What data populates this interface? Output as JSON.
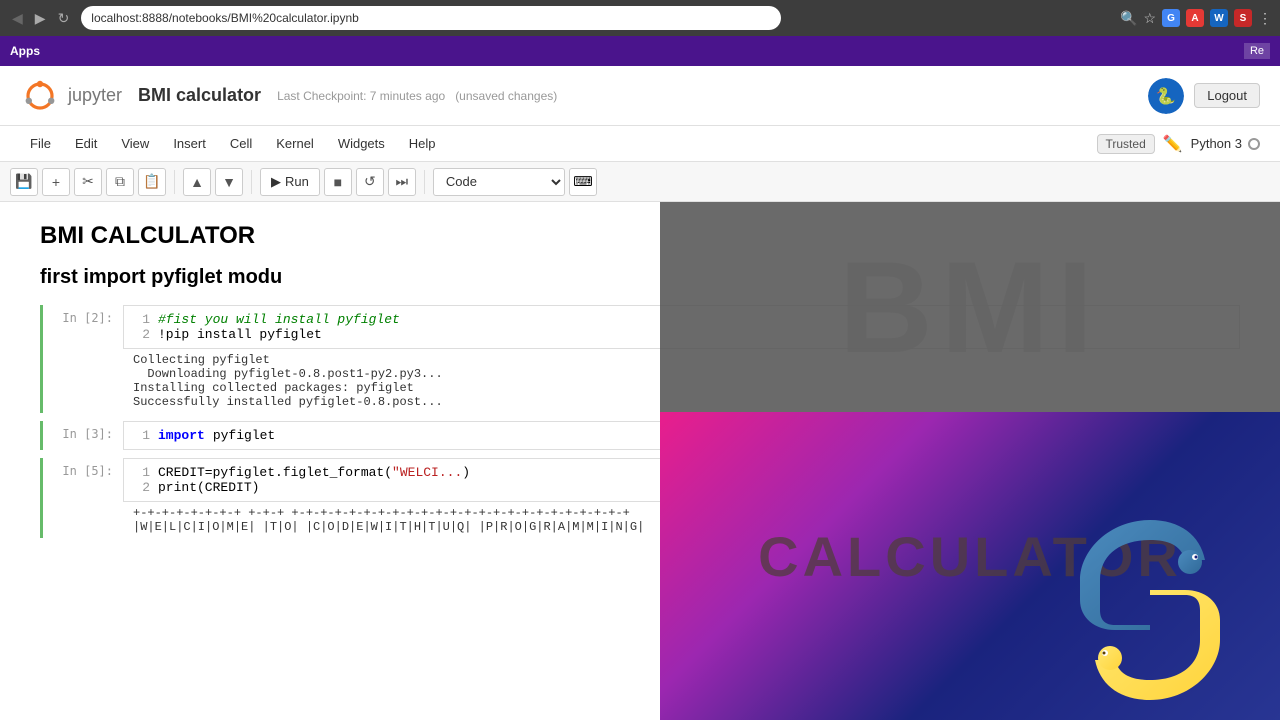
{
  "browser": {
    "url": "localhost:8888/notebooks/BMI%20calculator.ipynb",
    "nav_back": "◀",
    "nav_forward": "▶",
    "reload": "↻"
  },
  "apps": {
    "label": "Apps",
    "re_label": "Re"
  },
  "jupyter": {
    "logo_text": "jupyter",
    "notebook_title": "BMI calculator",
    "checkpoint_info": "Last Checkpoint: 7 minutes ago",
    "unsaved": "(unsaved changes)",
    "logout_label": "Logout"
  },
  "menu": {
    "items": [
      "File",
      "Edit",
      "View",
      "Insert",
      "Cell",
      "Kernel",
      "Widgets",
      "Help"
    ],
    "trusted": "Trusted",
    "kernel_name": "Python 3"
  },
  "toolbar": {
    "run_label": "Run",
    "cell_type": "Code"
  },
  "notebook": {
    "heading": "BMI CALCULATOR",
    "subheading": "first import pyfiglet modu",
    "cells": [
      {
        "prompt": "In [2]:",
        "lines": [
          {
            "num": "1",
            "content": "#fist you will install pyfiglet",
            "type": "comment"
          },
          {
            "num": "2",
            "content": "!pip install pyfiglet",
            "type": "code"
          }
        ],
        "output_lines": [
          "Collecting pyfiglet",
          "  Downloading pyfiglet-0.8.post1-py2.py3...",
          "Installing collected packages: pyfiglet",
          "Successfully installed pyfiglet-0.8.post..."
        ]
      },
      {
        "prompt": "In [3]:",
        "lines": [
          {
            "num": "1",
            "content_before": "",
            "kw": "import",
            "content_after": " pyfiglet",
            "type": "import"
          }
        ]
      },
      {
        "prompt": "In [5]:",
        "lines": [
          {
            "num": "1",
            "content": "CREDIT=pyfiglet.figlet_format(\"WELCI...",
            "type": "code"
          },
          {
            "num": "2",
            "content": "print(CREDIT)",
            "type": "code"
          }
        ],
        "output_lines": [
          "+-+-+-+-+-+-+-+ +-+-+ +-+-+-+-+-+-+-+-+-+-+-+-+-+-+-+-+-+-+-+-+-+-+-+",
          "|W|E|L|C|I|O|M|E| |T|O| |C|O|D|E|W|I|T|H|T|U|Q| |P|R|O|G|R|A|M|M|I|N|G|"
        ]
      }
    ]
  },
  "bmi_overlay": {
    "top_text": "BMI",
    "bottom_text": "CALCULATOR"
  }
}
